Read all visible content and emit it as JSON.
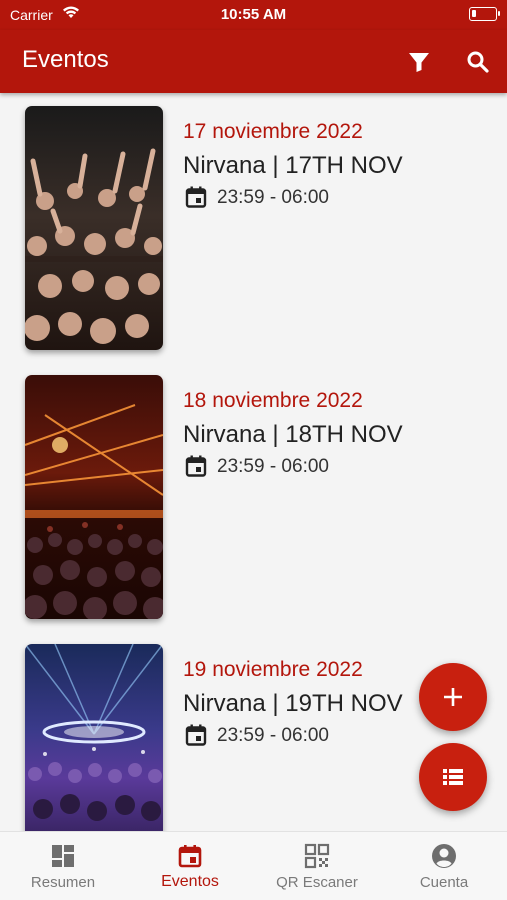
{
  "status_bar": {
    "carrier": "Carrier",
    "time": "10:55 AM",
    "battery_level": 0.2
  },
  "app_bar": {
    "title": "Eventos",
    "filter_icon": "filter-icon",
    "search_icon": "search-icon"
  },
  "events": [
    {
      "date": "17 noviembre 2022",
      "name": "Nirvana | 17TH NOV",
      "time": "23:59 - 06:00"
    },
    {
      "date": "18 noviembre 2022",
      "name": "Nirvana | 18TH NOV",
      "time": "23:59 - 06:00"
    },
    {
      "date": "19 noviembre 2022",
      "name": "Nirvana | 19TH NOV",
      "time": "23:59 - 06:00"
    }
  ],
  "fabs": [
    {
      "icon": "plus-icon"
    },
    {
      "icon": "list-icon"
    }
  ],
  "tabs": [
    {
      "label": "Resumen",
      "icon": "dashboard-icon",
      "active": false
    },
    {
      "label": "Eventos",
      "icon": "calendar-icon",
      "active": true
    },
    {
      "label": "QR Escaner",
      "icon": "qr-code-icon",
      "active": false
    },
    {
      "label": "Cuenta",
      "icon": "account-icon",
      "active": false
    }
  ],
  "colors": {
    "primary": "#b3160c",
    "fab": "#c8200f",
    "tab_inactive": "#7a7a7a"
  }
}
